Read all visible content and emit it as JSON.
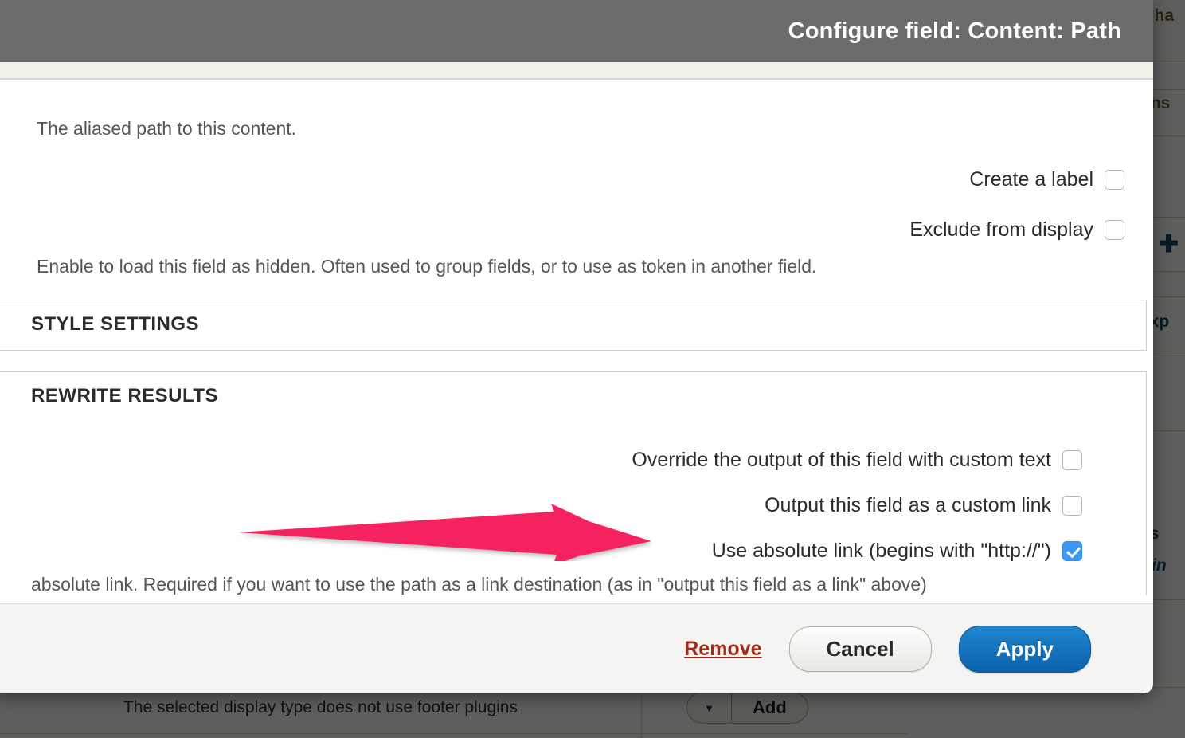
{
  "modal": {
    "title": "Configure field: Content: Path",
    "help_top": ".The aliased path to this content",
    "fields": [
      {
        "label": "Create a label",
        "checked": false
      },
      {
        "label": "Exclude from display",
        "checked": false
      }
    ],
    "help_hidden": ".Enable to load this field as hidden. Often used to group fields, or to use as token in another field",
    "style_settings_title": "STYLE SETTINGS",
    "rewrite_results_title": "REWRITE RESULTS",
    "rewrite_fields": [
      {
        "label": "Override the output of this field with custom text",
        "checked": false
      },
      {
        "label": "Output this field as a custom link",
        "checked": false
      },
      {
        "label": "Use absolute link (begins with \"http://\")",
        "checked": true
      }
    ],
    "help_absolute": "absolute link. Required if you want to use the path as a link destination (as in \"output this field as a link\" above)",
    "footer": {
      "remove_label": "Remove",
      "cancel_label": "Cancel",
      "apply_label": "Apply"
    }
  },
  "background": {
    "footer_message": "The selected display type does not use footer plugins",
    "add_button_label": "Add",
    "dropdown_arrow": "▼",
    "right_fragments": [
      "k ha",
      "uns",
      "exp",
      "s  /",
      "ttin"
    ],
    "plus_icon": "✚"
  },
  "annotation": {
    "arrow_color": "#f5245f",
    "arrow_direction": "right"
  },
  "colors": {
    "header_bg": "#6c6c6c",
    "subbar_bg": "#f2f2eb",
    "footer_bg": "#f4f4f2",
    "apply_blue": "#1070b8",
    "remove_red": "#a32a17",
    "checkbox_checked": "#3b99f5",
    "arrow_pink": "#f5245f",
    "overlay": "rgba(0,0,0,0.62)"
  }
}
